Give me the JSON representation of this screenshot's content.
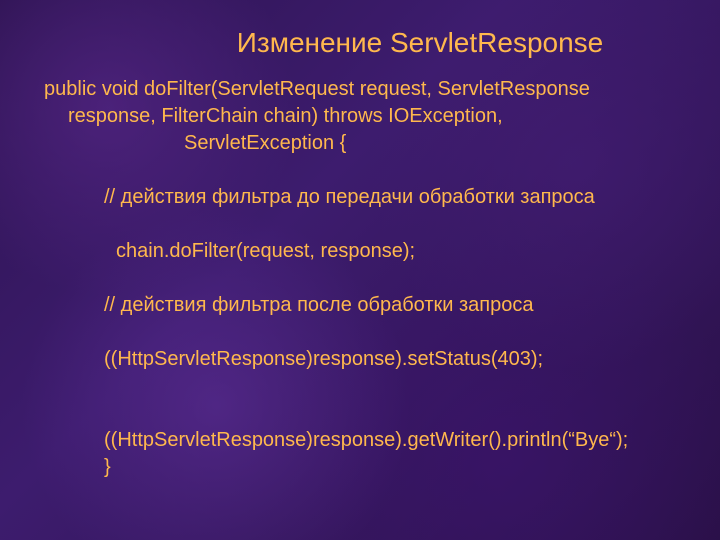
{
  "title": "Изменение ServletResponse",
  "code": {
    "l1": "public void doFilter(ServletRequest request, ServletResponse",
    "l2": "response, FilterChain chain) throws IOException,",
    "l3": "ServletException {",
    "l4": "// действия фильтра до передачи обработки запроса",
    "l5": "chain.doFilter(request, response);",
    "l6": "// действия фильтра после обработки запроса",
    "l7": "((HttpServletResponse)response).setStatus(403);",
    "l8": "((HttpServletResponse)response).getWriter().println(“Bye“);",
    "l9": "}"
  }
}
